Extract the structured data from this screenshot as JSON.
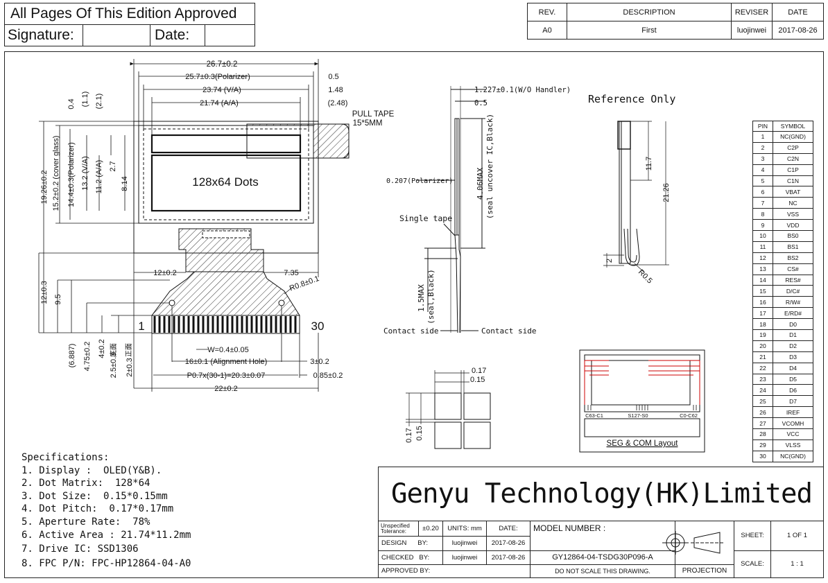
{
  "approval": {
    "title": "All Pages Of This Edition Approved",
    "signature_label": "Signature:",
    "date_label": "Date:"
  },
  "revision": {
    "headers": [
      "REV.",
      "DESCRIPTION",
      "REVISER",
      "DATE"
    ],
    "rows": [
      [
        "A0",
        "First",
        "luojinwei",
        "2017-08-26"
      ]
    ]
  },
  "front_view": {
    "dims": {
      "overall_width": "26.7±0.2",
      "polarizer_width": "25.7±0.3(Polarizer)",
      "va_width": "23.74 (V/A)",
      "aa_width": "21.74 (A/A)",
      "d_0_5": "0.5",
      "d_1_48": "1.48",
      "d_2_48": "(2.48)",
      "d_0_4": "0.4",
      "d_1_1": "(1.1)",
      "d_2_1": "(2.1)",
      "overall_height": "19.26±0.2",
      "cover_glass": "15.2±0.2 (cover glass)",
      "polarizer_height": "14.4±0.3(Polarizer)",
      "va_height": "13.2 (V/A)",
      "aa_height": "11.2 (A/A)",
      "d_2_7": "2.7",
      "d_8_14": "8.14",
      "fpc_left": "12±0.2",
      "fpc_right": "7.35",
      "hole_r": "R0.8±0.1",
      "fpc_h": "12±0.3",
      "d_9_5": "9.5",
      "d_6_887": "(6.887)",
      "d_4_75": "4.75±0.2",
      "d_4": "4±0.2",
      "d_2_5": "2.5±0.3",
      "d_2": "2±0.3",
      "back_label": "底面",
      "front_label": "正面",
      "pad_width": "W=0.4±0.05",
      "align_hole": "16±0.1 (Alignment Hole)",
      "d_3": "3±0.2",
      "pitch": "P0.7x(30-1)=20.3±0.07",
      "d_0_85": "0.85±0.2",
      "fpc_width": "22±0.2"
    },
    "pull_tape": "PULL TAPE",
    "pull_tape_size": "15*5MM",
    "display_label": "128x64 Dots",
    "pin_first": "1",
    "pin_last": "30"
  },
  "side_view": {
    "thickness": "1.227±0.1(W/O Handler)",
    "d_0_5": "0.5",
    "polarizer": "0.207(Polarizer)",
    "max_4_06": "4.06MAX",
    "seal_uncover": "(seal uncover IC,Black)",
    "single_tape": "Single tape",
    "max_1_5": "1.5MAX",
    "seal_black": "(seal,Black)",
    "contact_left": "Contact side",
    "contact_right": "Contact side"
  },
  "reference": {
    "title": "Reference Only",
    "d_11_7": "11.7",
    "d_21_26": "21.26",
    "d_2": "2",
    "radius": "R0.5"
  },
  "dot_detail": {
    "pitch_h": "0.17",
    "size_h": "0.15",
    "pitch_v": "0.17",
    "size_v": "0.15"
  },
  "seg_com": {
    "title": "SEG & COM Layout",
    "left": "C63-C1",
    "mid": "S127-S0",
    "right": "C0-C62"
  },
  "pins": {
    "headers": [
      "PIN",
      "SYMBOL"
    ],
    "rows": [
      [
        "1",
        "NC(GND)"
      ],
      [
        "2",
        "C2P"
      ],
      [
        "3",
        "C2N"
      ],
      [
        "4",
        "C1P"
      ],
      [
        "5",
        "C1N"
      ],
      [
        "6",
        "VBAT"
      ],
      [
        "7",
        "NC"
      ],
      [
        "8",
        "VSS"
      ],
      [
        "9",
        "VDD"
      ],
      [
        "10",
        "BS0"
      ],
      [
        "11",
        "BS1"
      ],
      [
        "12",
        "BS2"
      ],
      [
        "13",
        "CS#"
      ],
      [
        "14",
        "RES#"
      ],
      [
        "15",
        "D/C#"
      ],
      [
        "16",
        "R/W#"
      ],
      [
        "17",
        "E/RD#"
      ],
      [
        "18",
        "D0"
      ],
      [
        "19",
        "D1"
      ],
      [
        "20",
        "D2"
      ],
      [
        "21",
        "D3"
      ],
      [
        "22",
        "D4"
      ],
      [
        "23",
        "D5"
      ],
      [
        "24",
        "D6"
      ],
      [
        "25",
        "D7"
      ],
      [
        "26",
        "IREF"
      ],
      [
        "27",
        "VCOMH"
      ],
      [
        "28",
        "VCC"
      ],
      [
        "29",
        "VLSS"
      ],
      [
        "30",
        "NC(GND)"
      ]
    ]
  },
  "specifications": {
    "title": "Specifications:",
    "items": [
      "1. Display :  OLED(Y&B).",
      "2. Dot Matrix:  128*64",
      "3. Dot Size:  0.15*0.15mm",
      "4. Dot Pitch:  0.17*0.17mm",
      "5. Aperture Rate:  78%",
      "6. Active Area : 21.74*11.2mm",
      "7. Drive IC: SSD1306",
      "8. FPC P/N: FPC-HP12864-04-A0"
    ]
  },
  "title_block": {
    "company": "Genyu Technology(HK)Limited",
    "tol_label": "Unspecified Tolerance:",
    "tol_value": "±0.20",
    "units": "UNITS: mm",
    "date_h": "DATE:",
    "model_label": "MODEL NUMBER :",
    "model": "GY12864-04-TSDG30P096-A",
    "design_label": "DESIGN",
    "by1": "BY:",
    "design_by": "luojinwei",
    "design_date": "2017-08-26",
    "checked_label": "CHECKED",
    "by2": "BY:",
    "checked_by": "luojinwei",
    "checked_date": "2017-08-26",
    "approved_label": "APPROVED BY:",
    "no_scale": "DO NOT SCALE THIS DRAWING.",
    "projection": "PROJECTION",
    "sheet_label": "SHEET:",
    "sheet": "1  OF  1",
    "scale_label": "SCALE:",
    "scale": "1 : 1"
  }
}
